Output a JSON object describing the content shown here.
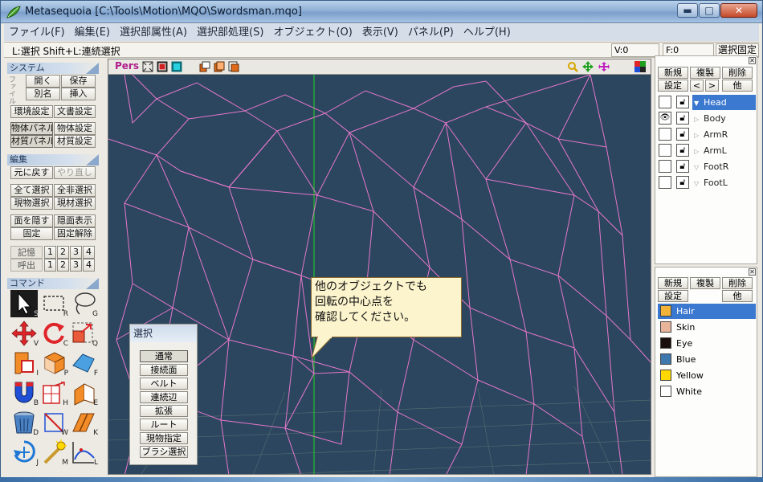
{
  "window": {
    "title": "Metasequoia [C:\\Tools\\Motion\\MQO\\Swordsman.mqo]",
    "buttons": {
      "minimize": "▬",
      "maximize": "□",
      "close": "✕"
    }
  },
  "menu": [
    "ファイル(F)",
    "編集(E)",
    "選択部属性(A)",
    "選択部処理(S)",
    "オブジェクト(O)",
    "表示(V)",
    "パネル(P)",
    "ヘルプ(H)"
  ],
  "status": {
    "hint": "L:選択   Shift+L:連続選択",
    "vertices": "V:0",
    "faces": "F:0",
    "lock": "選択固定"
  },
  "left": {
    "system": {
      "header": "システム",
      "file_label": "ファイル",
      "open": "開く",
      "save": "保存",
      "save_as": "別名",
      "insert": "挿入",
      "env": "環境設定",
      "doc": "文書設定",
      "obj_panel": "物体パネル",
      "obj_settings": "物体設定",
      "mat_panel": "材質パネル",
      "mat_settings": "材質設定"
    },
    "edit": {
      "header": "編集",
      "undo": "元に戻す",
      "redo": "やり直し",
      "select_all": "全て選択",
      "deselect_all": "全非選択",
      "select_current_obj": "現物選択",
      "select_current_mat": "現材選択",
      "hide_faces": "面を隠す",
      "show_hidden": "隠面表示",
      "fix": "固定",
      "unfix": "固定解除",
      "memory": "記憶",
      "recall": "呼出",
      "slots": [
        "1",
        "2",
        "3",
        "4"
      ]
    },
    "command": {
      "header": "コマンド",
      "tools": [
        {
          "icon": "select-arrow-icon",
          "key": "S"
        },
        {
          "icon": "rect-select-icon",
          "key": "R"
        },
        {
          "icon": "lasso-icon",
          "key": "G"
        },
        {
          "icon": "move-icon",
          "key": "V"
        },
        {
          "icon": "rotate-icon",
          "key": "C"
        },
        {
          "icon": "scale-icon",
          "key": "Q"
        },
        {
          "icon": "create-face-icon",
          "key": "I"
        },
        {
          "icon": "primitive-icon",
          "key": "P"
        },
        {
          "icon": "face-icon",
          "key": "F"
        },
        {
          "icon": "magnet-icon",
          "key": "B"
        },
        {
          "icon": "grid-icon",
          "key": "H"
        },
        {
          "icon": "extrude-icon",
          "key": "E"
        },
        {
          "icon": "delete-bucket-icon",
          "key": "D"
        },
        {
          "icon": "knife-icon",
          "key": "W"
        },
        {
          "icon": "edge-icon",
          "key": "K"
        },
        {
          "icon": "weld-icon",
          "key": "J"
        },
        {
          "icon": "magic-wand-icon",
          "key": "M"
        },
        {
          "icon": "curve-icon",
          "key": "L"
        }
      ]
    }
  },
  "viewport": {
    "projection": "Pers",
    "tooltip": [
      "他のオブジェクトでも",
      "回転の中心点を",
      "確認してください。"
    ]
  },
  "select_panel": {
    "title": "選択",
    "options": [
      "通常",
      "接続面",
      "ベルト",
      "連続辺",
      "拡張",
      "ルート",
      "現物指定",
      "ブラシ選択"
    ],
    "active": "通常"
  },
  "object_panel": {
    "new": "新規",
    "duplicate": "複製",
    "delete": "削除",
    "settings": "設定",
    "prev": "<",
    "next": ">",
    "other": "他",
    "objects": [
      {
        "name": "Head",
        "visible": false,
        "selected": true
      },
      {
        "name": "Body",
        "visible": true,
        "selected": false
      },
      {
        "name": "ArmR",
        "visible": false,
        "selected": false
      },
      {
        "name": "ArmL",
        "visible": false,
        "selected": false
      },
      {
        "name": "FootR",
        "visible": false,
        "selected": false
      },
      {
        "name": "FootL",
        "visible": false,
        "selected": false
      }
    ]
  },
  "material_panel": {
    "new": "新規",
    "duplicate": "複製",
    "delete": "削除",
    "settings": "設定",
    "other": "他",
    "materials": [
      {
        "name": "Hair",
        "color": "#f3b238",
        "selected": true
      },
      {
        "name": "Skin",
        "color": "#e8b49a",
        "selected": false
      },
      {
        "name": "Eye",
        "color": "#1a0f0c",
        "selected": false
      },
      {
        "name": "Blue",
        "color": "#3e78ad",
        "selected": false
      },
      {
        "name": "Yellow",
        "color": "#ffd800",
        "selected": false
      },
      {
        "name": "White",
        "color": "#ffffff",
        "selected": false
      }
    ]
  },
  "colors": {
    "accent": "#3b78cf",
    "viewport_bg": "#2c4660",
    "wire": "#e477c8",
    "axis": "#22c22a"
  }
}
